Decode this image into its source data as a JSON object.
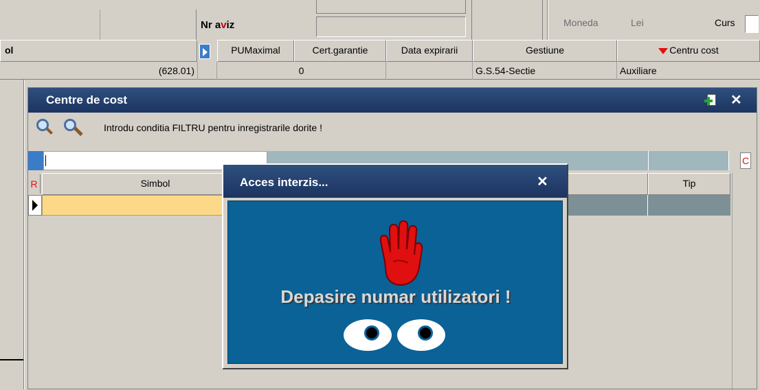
{
  "top": {
    "nr_aviz_label_part1": "Nr a",
    "nr_aviz_label_v": "v",
    "nr_aviz_label_part2": "iz",
    "moneda_label": "Moneda",
    "moneda_value": "Lei",
    "curs_label": "Curs"
  },
  "grid_header": {
    "col_left": "ol",
    "columns": [
      "PUMaximal",
      "Cert.garantie",
      "Data expirarii",
      "Gestiune",
      "Centru cost"
    ]
  },
  "grid_row": {
    "value1": "(628.01)",
    "value2": "0",
    "gestiune": "G.S.54-Sectie",
    "centru_cost": "Auxiliare"
  },
  "centre_window": {
    "title": "Centre de cost",
    "filter_text": "Introdu conditia FILTRU pentru inregistrarile dorite !",
    "filter_input_value": "",
    "col_marker_r": "R",
    "col_marker_c": "C",
    "columns": [
      "Simbol",
      "Tip"
    ]
  },
  "dialog": {
    "title": "Acces interzis...",
    "message": "Depasire numar utilizatori !"
  },
  "colors": {
    "title_bar": "#1c3461",
    "dialog_body": "#0a6297",
    "grid_selected_row": "#fbd988",
    "hand_red": "#e01010"
  },
  "icons": [
    "search-icon",
    "search-advanced-icon",
    "add-icon",
    "close-icon",
    "hand-stop-icon",
    "eyes-icon",
    "sort-down-icon",
    "row-pointer-icon"
  ]
}
